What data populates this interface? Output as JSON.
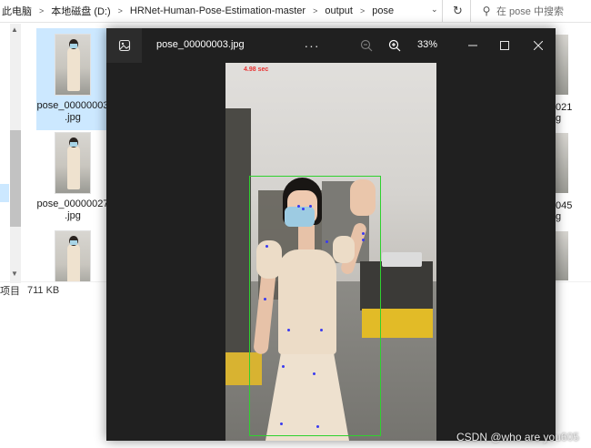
{
  "explorer": {
    "breadcrumb": [
      "此电脑",
      "本地磁盘 (D:)",
      "HRNet-Human-Pose-Estimation-master",
      "output",
      "pose"
    ],
    "search_placeholder": "在 pose 中搜索",
    "files": [
      {
        "name_line1": "pose_00000003",
        "name_line2": ".jpg",
        "selected": true
      },
      {
        "name_line1": "pose_00000027",
        "name_line2": ".jpg",
        "selected": false
      },
      {
        "name_line1": "",
        "name_line2": "",
        "selected": false
      }
    ],
    "right_column": [
      {
        "line1": "021",
        "line2": "g"
      },
      {
        "line1": "045",
        "line2": "g"
      }
    ],
    "status": {
      "items": "项目",
      "size": "711 KB"
    }
  },
  "viewer": {
    "title": "pose_00000003.jpg",
    "more_glyph": "···",
    "zoom_level": "33%",
    "overlay_time": "4.98 sec",
    "icons": [
      "photo-icon",
      "zoom-out-icon",
      "zoom-in-icon",
      "minimize-icon",
      "maximize-icon",
      "close-icon"
    ]
  },
  "watermark": "CSDN @who are you605",
  "colors": {
    "viewer_bg": "#202020",
    "bbox": "#2fd12f",
    "keypoint": "#3a3af0",
    "selection": "#cce8ff",
    "overlay_text": "#e83232"
  }
}
